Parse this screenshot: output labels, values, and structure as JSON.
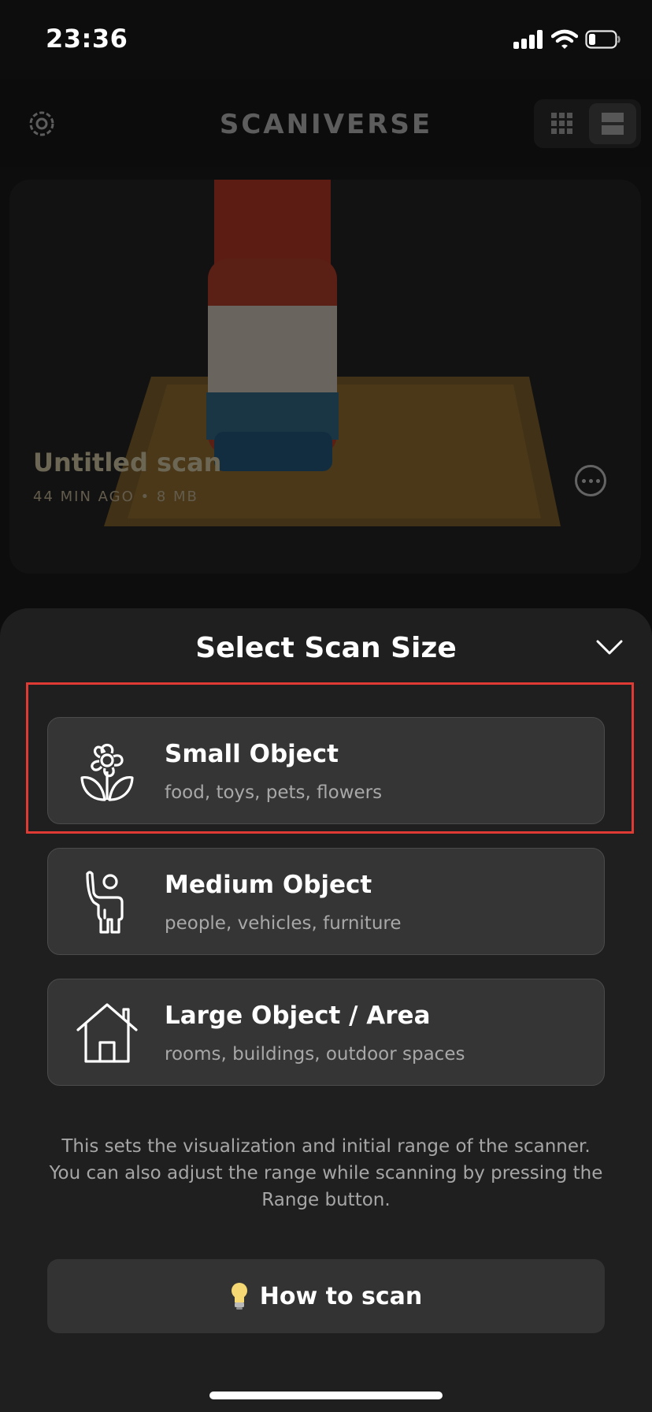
{
  "status_bar": {
    "time": "23:36"
  },
  "header": {
    "title": "SCANIVERSE",
    "settings_icon": "gear-icon",
    "grid_icon": "grid-view-icon",
    "list_icon": "list-view-icon"
  },
  "scan": {
    "name": "Untitled scan",
    "meta": "44 MIN AGO  •  8 MB",
    "more_icon": "ellipsis-icon"
  },
  "sheet": {
    "title": "Select Scan Size",
    "collapse_icon": "chevron-down-icon",
    "options": [
      {
        "title": "Small Object",
        "subtitle": "food, toys, pets, flowers",
        "icon": "flower-icon"
      },
      {
        "title": "Medium Object",
        "subtitle": "people, vehicles, furniture",
        "icon": "person-waving-icon"
      },
      {
        "title": "Large Object / Area",
        "subtitle": "rooms, buildings, outdoor spaces",
        "icon": "house-icon"
      }
    ],
    "note": "This sets the visualization and initial range of the scanner. You can also adjust the range while scanning by pressing the Range button.",
    "how_to_scan": "How to scan",
    "how_to_scan_icon": "light-bulb-icon"
  },
  "colors": {
    "highlight": "#e03a34",
    "sheet_bg": "#1f1f1f",
    "card_bg": "#353535"
  }
}
